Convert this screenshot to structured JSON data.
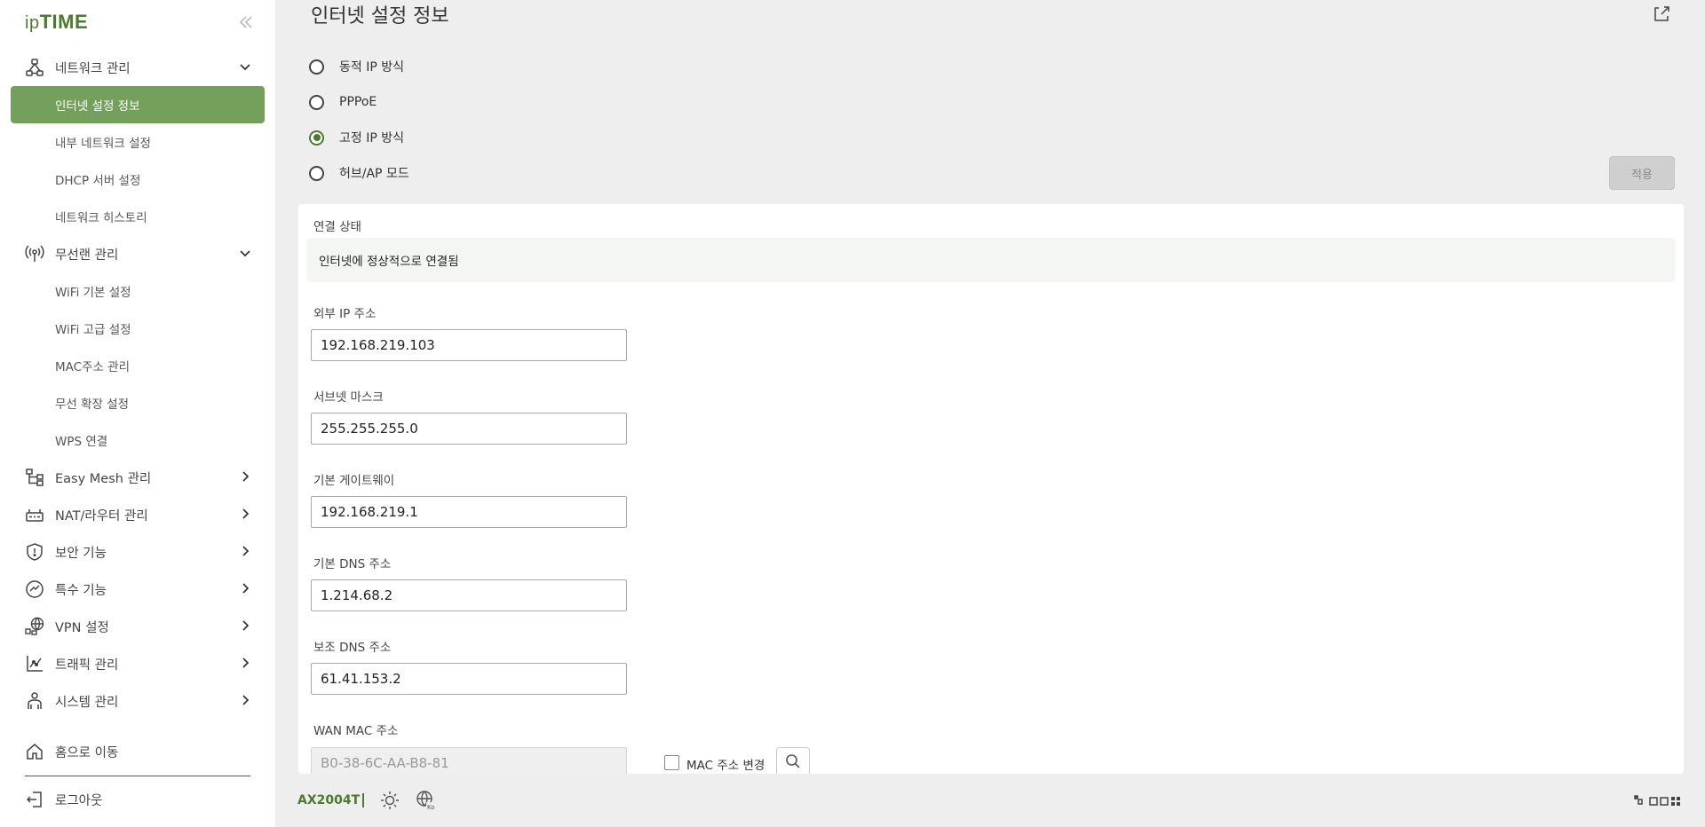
{
  "brand": {
    "prefix": "ip",
    "name": "TIME",
    "accent_color": "#4c7a2e",
    "active_menu_color": "#73a05a"
  },
  "sidebar": {
    "collapse_icon": "double-chevron-left",
    "groups": [
      {
        "label": "네트워크 관리",
        "icon": "network-icon",
        "expanded": true
      },
      {
        "label": "무선랜 관리",
        "icon": "wireless-icon",
        "expanded": true
      },
      {
        "label": "Easy Mesh 관리",
        "icon": "mesh-icon",
        "expanded": false
      },
      {
        "label": "NAT/라우터 관리",
        "icon": "router-icon",
        "expanded": false
      },
      {
        "label": "보안 기능",
        "icon": "shield-icon",
        "expanded": false
      },
      {
        "label": "특수 기능",
        "icon": "special-icon",
        "expanded": false
      },
      {
        "label": "VPN 설정",
        "icon": "vpn-globe-icon",
        "expanded": false
      },
      {
        "label": "트래픽 관리",
        "icon": "traffic-chart-icon",
        "expanded": false
      },
      {
        "label": "시스템 관리",
        "icon": "system-icon",
        "expanded": false
      }
    ],
    "network_items": [
      "인터넷 설정 정보",
      "내부 네트워크 설정",
      "DHCP 서버 설정",
      "네트워크 히스토리"
    ],
    "wireless_items": [
      "WiFi 기본 설정",
      "WiFi 고급 설정",
      "MAC주소 관리",
      "무선 확장 설정",
      "WPS 연결"
    ],
    "active_item": "인터넷 설정 정보",
    "home": "홈으로 이동",
    "logout": "로그아웃"
  },
  "main": {
    "title": "인터넷 설정 정보",
    "connection_types": [
      {
        "label": "동적 IP 방식",
        "selected": false
      },
      {
        "label": "PPPoE",
        "selected": false
      },
      {
        "label": "고정 IP 방식",
        "selected": true
      },
      {
        "label": "허브/AP 모드",
        "selected": false
      }
    ],
    "apply_label": "적용",
    "status": {
      "label": "연결 상태",
      "value": "인터넷에 정상적으로 연결됨"
    },
    "fields": {
      "external_ip": {
        "label": "외부 IP 주소",
        "value": "192.168.219.103"
      },
      "subnet": {
        "label": "서브넷 마스크",
        "value": "255.255.255.0"
      },
      "gateway": {
        "label": "기본 게이트웨이",
        "value": "192.168.219.1"
      },
      "dns1": {
        "label": "기본 DNS 주소",
        "value": "1.214.68.2"
      },
      "dns2": {
        "label": "보조 DNS 주소",
        "value": "61.41.153.2"
      },
      "wan_mac": {
        "label": "WAN MAC 주소",
        "value": "B0-38-6C-AA-B8-81",
        "disabled": true
      }
    },
    "mac_change_label": "MAC 주소 변경",
    "mac_change_checked": false
  },
  "footer": {
    "model": "AX2004T",
    "icons": [
      "brightness-icon",
      "language-globe-icon",
      "layout-toggle-icon"
    ]
  }
}
